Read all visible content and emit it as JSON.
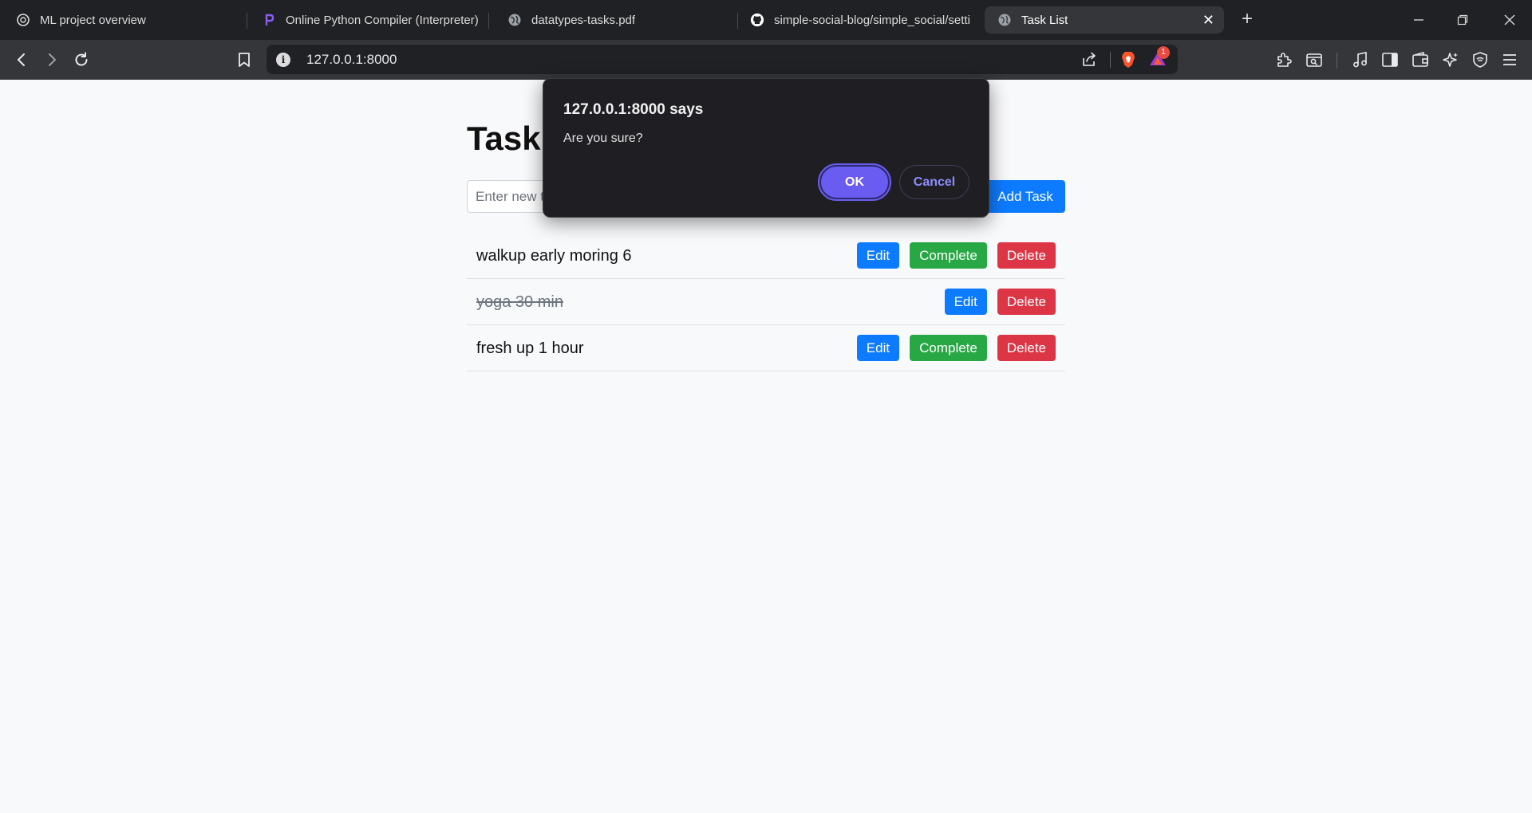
{
  "browser": {
    "tabs": [
      {
        "title": "ML project overview",
        "icon": "openai-icon"
      },
      {
        "title": "Online Python Compiler (Interpreter)",
        "icon": "programiz-icon"
      },
      {
        "title": "datatypes-tasks.pdf",
        "icon": "globe-icon"
      },
      {
        "title": "simple-social-blog/simple_social/settings.py",
        "icon": "github-icon"
      },
      {
        "title": "Task List",
        "icon": "globe-icon",
        "active": true
      }
    ],
    "close_tab_label": "✕",
    "new_tab_label": "+",
    "url": "127.0.0.1:8000",
    "rewards_badge": "1"
  },
  "page": {
    "title": "Task List",
    "input_placeholder": "Enter new task",
    "add_button": "Add Task",
    "tasks": [
      {
        "text": "walkup early moring 6",
        "completed": false
      },
      {
        "text": "yoga 30 min",
        "completed": true
      },
      {
        "text": "fresh up 1 hour",
        "completed": false
      }
    ],
    "edit_label": "Edit",
    "complete_label": "Complete",
    "delete_label": "Delete"
  },
  "dialog": {
    "title": "127.0.0.1:8000 says",
    "message": "Are you sure?",
    "ok_label": "OK",
    "cancel_label": "Cancel"
  },
  "colors": {
    "primary": "#0d7bff",
    "success": "#28a745",
    "danger": "#dc3545",
    "dialog_accent": "#6a5cf0"
  }
}
